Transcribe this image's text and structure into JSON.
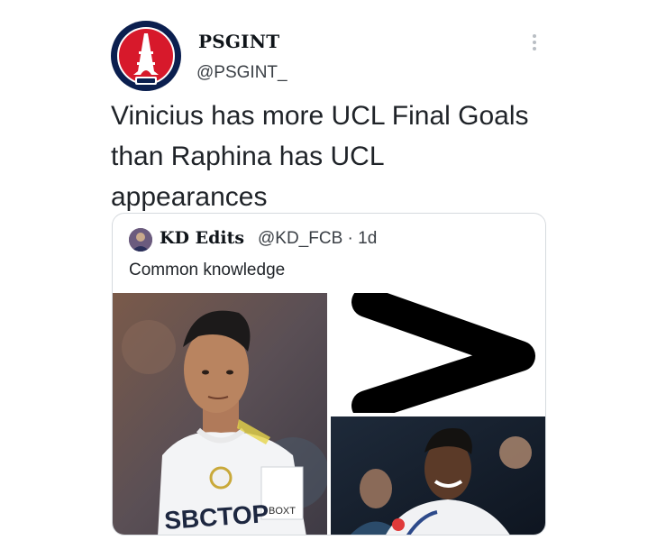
{
  "tweet": {
    "author": {
      "display_name": "PSGINT",
      "handle": "@PSGINT_",
      "avatar_icon": "psg-crest-icon"
    },
    "more_icon": "more-vertical-icon",
    "text": "Vinicius has more UCL Final Goals than Raphina has UCL appearances"
  },
  "quoted_tweet": {
    "author": {
      "display_name": "KD Edits",
      "handle": "@KD_FCB",
      "time": "1d"
    },
    "handle_time_separator": " · ",
    "text": "Common knowledge",
    "media": {
      "left_photo_shirt_text": "SBCTOP",
      "left_photo_badge_text": "BOXT",
      "right_top_symbol": ">",
      "right_bottom_photo_icon": "player-photo-icon"
    }
  },
  "colors": {
    "text_primary": "#0f1419",
    "text_secondary": "#3a3f45",
    "border": "#d6dade",
    "psg_navy": "#0b1f4f",
    "psg_red": "#d7192b"
  }
}
